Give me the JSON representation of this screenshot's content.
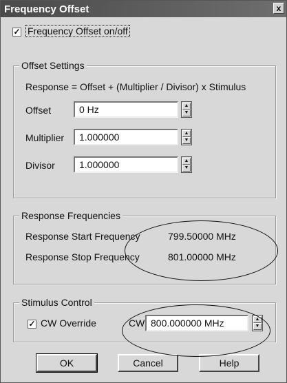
{
  "window": {
    "title": "Frequency Offset",
    "close_glyph": "x"
  },
  "offset_toggle": {
    "label": "Frequency Offset on/off",
    "checked": "✓"
  },
  "offset_settings": {
    "legend": "Offset Settings",
    "formula": "Response  =  Offset + (Multiplier / Divisor) x Stimulus",
    "fields": {
      "offset": {
        "label": "Offset",
        "value": "0 Hz"
      },
      "multiplier": {
        "label": "Multiplier",
        "value": "1.000000"
      },
      "divisor": {
        "label": "Divisor",
        "value": "1.000000"
      }
    }
  },
  "response_frequencies": {
    "legend": "Response Frequencies",
    "start": {
      "label": "Response Start Frequency",
      "value": "799.50000 MHz"
    },
    "stop": {
      "label": "Response Stop Frequency",
      "value": "801.00000 MHz"
    }
  },
  "stimulus_control": {
    "legend": "Stimulus Control",
    "cw_override": {
      "label": "CW Override",
      "checked": "✓"
    },
    "cw": {
      "label": "CW",
      "value": "800.000000 MHz"
    }
  },
  "buttons": {
    "ok": "OK",
    "cancel": "Cancel",
    "help": "Help"
  },
  "colors": {
    "titlebar": "#4a4a4a",
    "dialog_bg": "#d8d8d8",
    "annotation": "#111111"
  }
}
